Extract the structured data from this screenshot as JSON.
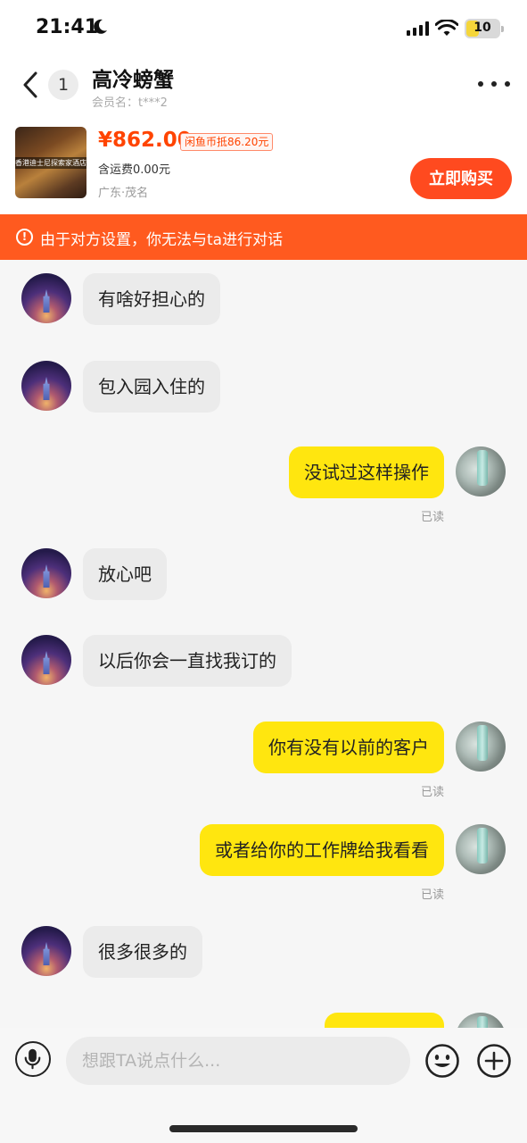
{
  "status_bar": {
    "time": "21:41",
    "battery": "10"
  },
  "header": {
    "unread_count": "1",
    "title": "高冷螃蟹",
    "subtitle": "会员名：t***2"
  },
  "product": {
    "image_caption": "香港迪士尼探索家酒店",
    "price": "¥862.00",
    "coin_tag": "闲鱼币抵86.20元",
    "shipping": "含运费0.00元",
    "location": "广东·茂名",
    "buy_label": "立即购买"
  },
  "notice": {
    "text": "由于对方设置，你无法与ta进行对话"
  },
  "messages": [
    {
      "side": "left",
      "text": "有啥好担心的"
    },
    {
      "side": "left",
      "text": "包入园入住的"
    },
    {
      "side": "right",
      "text": "没试过这样操作",
      "status": "已读"
    },
    {
      "side": "left",
      "text": "放心吧"
    },
    {
      "side": "left",
      "text": "以后你会一直找我订的"
    },
    {
      "side": "right",
      "text": "你有没有以前的客户",
      "status": "已读"
    },
    {
      "side": "right",
      "text": "或者给你的工作牌给我看看",
      "status": "已读"
    },
    {
      "side": "left",
      "text": "很多很多的"
    },
    {
      "side": "right",
      "text": ""
    }
  ],
  "input": {
    "placeholder": "想跟TA说点什么..."
  },
  "colors": {
    "accent": "#ff4400",
    "banner": "#ff5a1f",
    "my_bubble": "#ffe60f",
    "other_bubble": "#ebebeb"
  },
  "icons": [
    "moon-icon",
    "signal-icon",
    "wifi-icon",
    "back-icon",
    "more-icon",
    "warning-icon",
    "mic-icon",
    "emoji-icon",
    "plus-icon"
  ]
}
